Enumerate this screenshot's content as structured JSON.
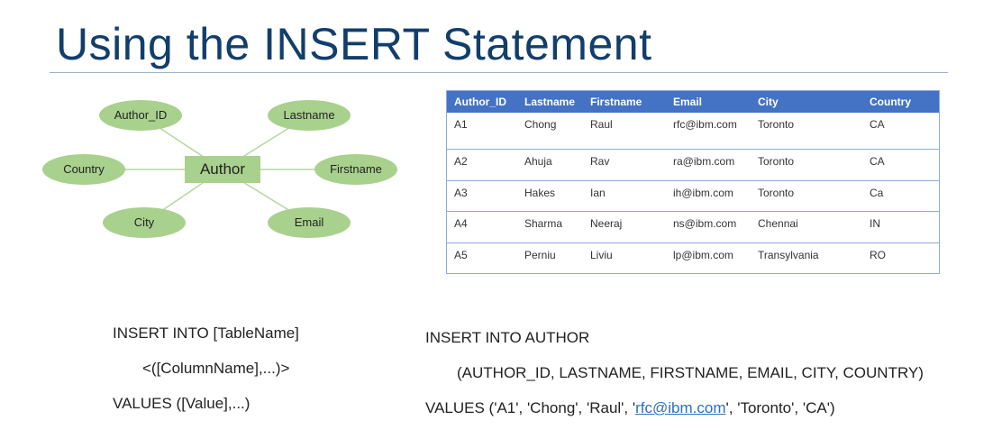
{
  "title": "Using the INSERT Statement",
  "er_diagram": {
    "entity": "Author",
    "attributes": {
      "author_id": "Author_ID",
      "lastname": "Lastname",
      "country": "Country",
      "firstname": "Firstname",
      "city": "City",
      "email": "Email"
    },
    "colors": {
      "ellipse_fill": "#a9d18e",
      "entity_fill": "#a9d18e",
      "line": "#b5d7a0"
    }
  },
  "table": {
    "headers": [
      "Author_ID",
      "Lastname",
      "Firstname",
      "Email",
      "City",
      "Country"
    ],
    "rows": [
      [
        "A1",
        "Chong",
        "Raul",
        "rfc@ibm.com",
        "Toronto",
        "CA"
      ],
      [
        "A2",
        "Ahuja",
        "Rav",
        "ra@ibm.com",
        "Toronto",
        "CA"
      ],
      [
        "A3",
        "Hakes",
        "Ian",
        "ih@ibm.com",
        "Toronto",
        "Ca"
      ],
      [
        "A4",
        "Sharma",
        "Neeraj",
        "ns@ibm.com",
        "Chennai",
        "IN"
      ],
      [
        "A5",
        "Perniu",
        "Liviu",
        "lp@ibm.com",
        "Transylvania",
        "RO"
      ]
    ],
    "header_color": "#4472c4"
  },
  "syntax": {
    "line1": "INSERT INTO [TableName]",
    "line2": "<([ColumnName],...)>",
    "line3": "VALUES ([Value],...)"
  },
  "example": {
    "line1": "INSERT INTO AUTHOR",
    "line2": "(AUTHOR_ID, LASTNAME, FIRSTNAME, EMAIL, CITY, COUNTRY)",
    "line3_prefix": "VALUES ('A1', 'Chong', 'Raul', '",
    "line3_link": "rfc@ibm.com",
    "line3_suffix": "', 'Toronto', 'CA')"
  },
  "title_color": "#123e6b"
}
